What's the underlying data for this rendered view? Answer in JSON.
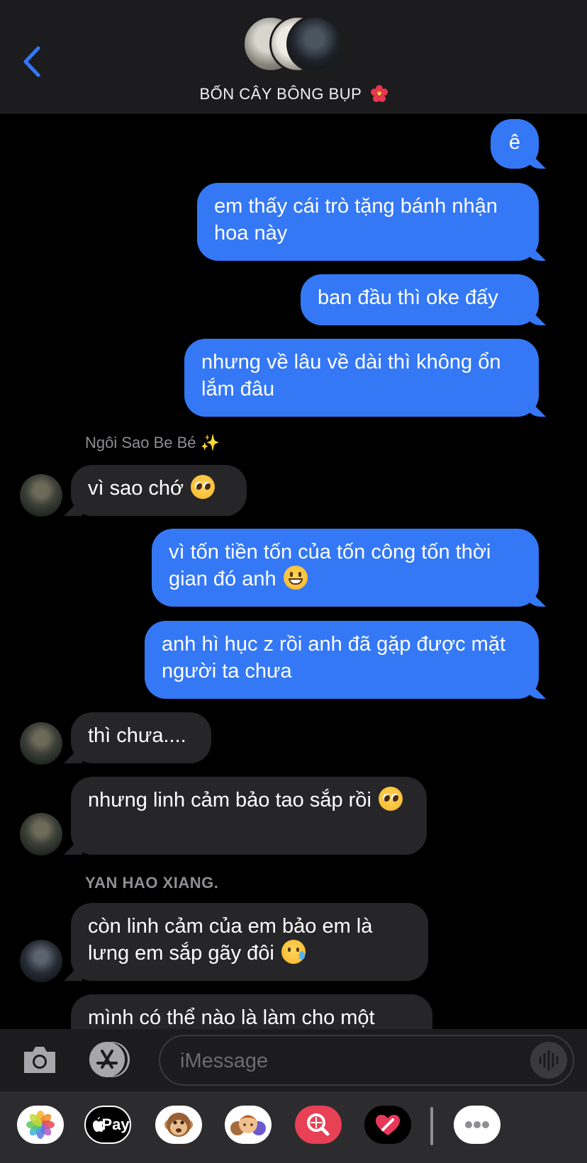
{
  "header": {
    "group_name": "BỐN CÂY BÔNG BỤP",
    "back_icon": "chevron-left-icon",
    "name_icon": "hibiscus-icon",
    "accent_color": "#3478f6"
  },
  "messages": [
    {
      "sender": "me",
      "text": "ê"
    },
    {
      "sender": "me",
      "text": "em thấy cái trò tặng bánh nhận hoa này"
    },
    {
      "sender": "me",
      "text": "ban đầu thì oke đấy"
    },
    {
      "sender": "me",
      "text": "nhưng về lâu về dài thì không ổn lắm đâu"
    },
    {
      "sender_label": "Ngôi Sao Be Bé ✨"
    },
    {
      "sender": "Ngôi Sao Be Bé",
      "text": "vì sao chớ",
      "emoji": "pleading-face-icon"
    },
    {
      "sender": "me",
      "text": "vì tốn tiền tốn của tốn công tốn thời gian đó anh",
      "emoji": "grinning-face-icon"
    },
    {
      "sender": "me",
      "text": "anh hì hục z rồi anh đã gặp được mặt người ta chưa"
    },
    {
      "sender": "Ngôi Sao Be Bé",
      "text": "thì chưa...."
    },
    {
      "sender": "Ngôi Sao Be Bé",
      "text": "nhưng linh cảm bảo tao sắp rồi",
      "emoji": "pleading-face-icon"
    },
    {
      "sender_label": "YAN HAO XIANG."
    },
    {
      "sender": "YAN HAO XIANG.",
      "text": "còn linh cảm của em bảo em là lưng em sắp gãy đôi",
      "emoji": "smiling-face-with-tear-icon"
    },
    {
      "sender": "YAN HAO XIANG.",
      "text": "mình có thể nào là làm cho một"
    }
  ],
  "input_bar": {
    "placeholder": "iMessage",
    "camera_icon": "camera-icon",
    "appstore_icon": "app-store-icon",
    "audio_icon": "waveform-icon"
  },
  "app_drawer": {
    "items": [
      "photos-icon",
      "apple-pay-icon",
      "animoji-icon",
      "memoji-icon",
      "image-search-icon",
      "digital-touch-icon",
      "more-icon"
    ],
    "apple_pay_label": "Pay"
  },
  "colors": {
    "sent_bubble": "#3478f6",
    "received_bubble": "#262628",
    "background": "#000000",
    "bar": "#1c1c1e"
  }
}
